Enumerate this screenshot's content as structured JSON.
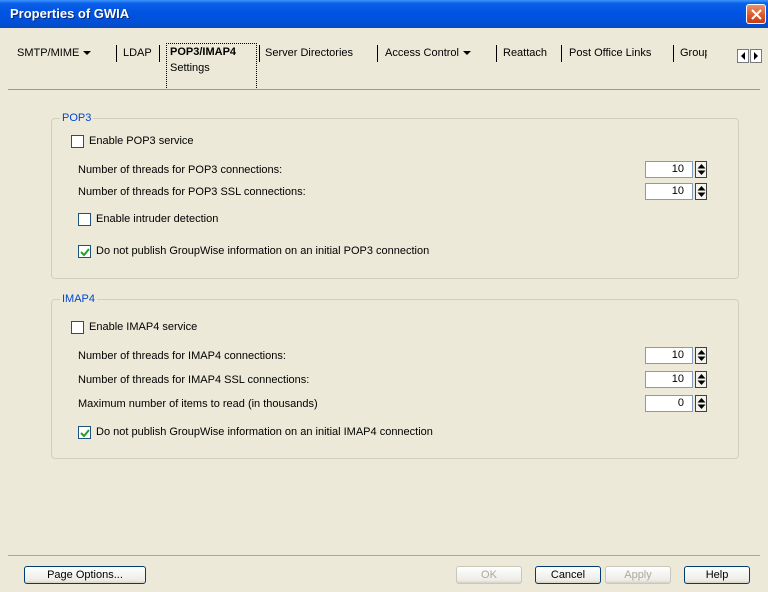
{
  "window": {
    "title": "Properties of GWIA"
  },
  "tabs": {
    "smtp": "SMTP/MIME",
    "ldap": "LDAP",
    "pop3imap4": "POP3/IMAP4",
    "pop3imap4_sub": "Settings",
    "server_dirs": "Server Directories",
    "access_control": "Access Control",
    "reattach": "Reattach",
    "po_links": "Post Office Links",
    "groupwise": "GroupW"
  },
  "pop3": {
    "title": "POP3",
    "enable_label": "Enable POP3 service",
    "enable_checked": false,
    "threads_label": "Number of threads for POP3 connections:",
    "threads_value": "10",
    "ssl_threads_label": "Number of threads for POP3 SSL connections:",
    "ssl_threads_value": "10",
    "intruder_label": "Enable intruder detection",
    "intruder_checked": false,
    "no_publish_label": "Do not publish GroupWise information on an initial POP3 connection",
    "no_publish_checked": true
  },
  "imap4": {
    "title": "IMAP4",
    "enable_label": "Enable IMAP4 service",
    "enable_checked": false,
    "threads_label": "Number of threads for IMAP4 connections:",
    "threads_value": "10",
    "ssl_threads_label": "Number of threads for IMAP4 SSL connections:",
    "ssl_threads_value": "10",
    "max_items_label": "Maximum number of items to read (in thousands)",
    "max_items_value": "0",
    "no_publish_label": "Do not publish GroupWise information on an initial IMAP4 connection",
    "no_publish_checked": true
  },
  "buttons": {
    "page_options": "Page Options...",
    "ok": "OK",
    "cancel": "Cancel",
    "apply": "Apply",
    "help": "Help"
  }
}
